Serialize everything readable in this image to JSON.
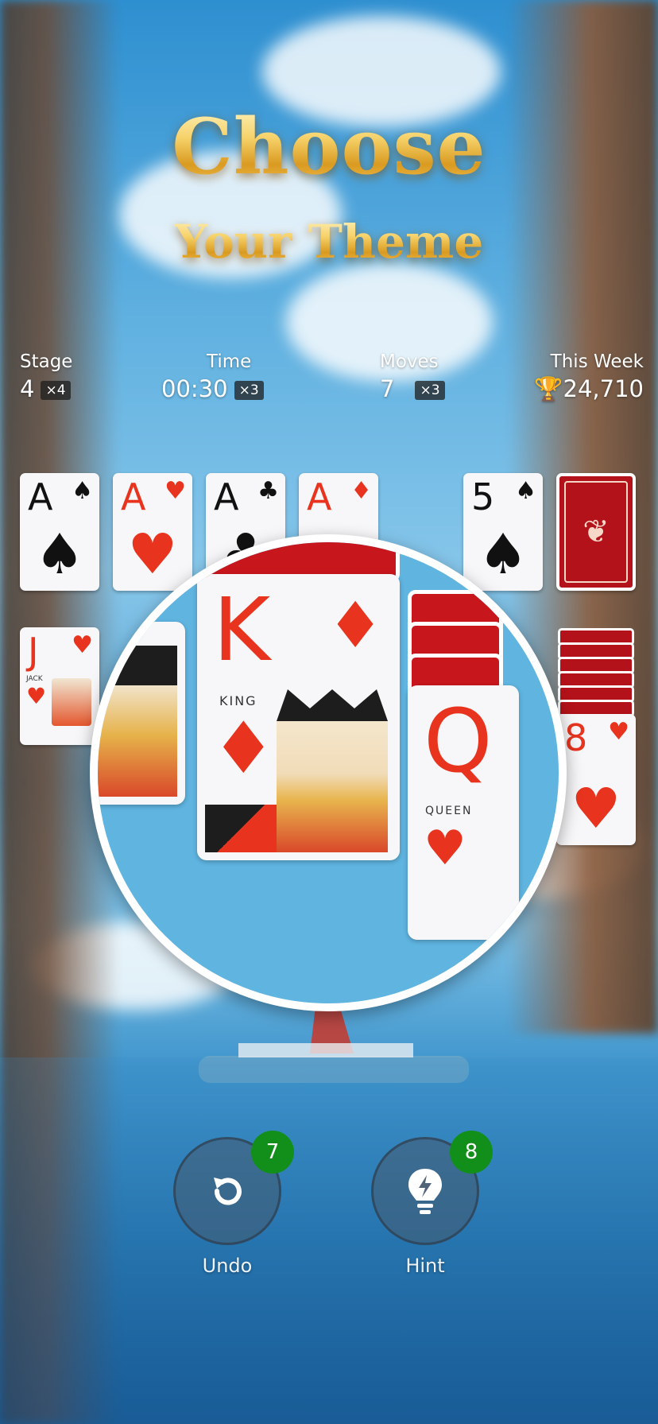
{
  "promo": {
    "title_line1": "Choose",
    "title_line2": "Your Theme"
  },
  "stats": {
    "stage": {
      "label": "Stage",
      "value": "4",
      "multiplier": "×4"
    },
    "time": {
      "label": "Time",
      "value": "00:30",
      "multiplier": "×3"
    },
    "moves": {
      "label": "Moves",
      "value": "7",
      "multiplier": "×3"
    },
    "week": {
      "label": "This Week",
      "value": "24,710",
      "icon": "trophy-icon"
    }
  },
  "foundations": [
    {
      "rank": "A",
      "suit": "♠",
      "color": "#111111"
    },
    {
      "rank": "A",
      "suit": "♥",
      "color": "#e8341e"
    },
    {
      "rank": "A",
      "suit": "♣",
      "color": "#111111"
    },
    {
      "rank": "A",
      "suit": "♦",
      "color": "#e8341e"
    }
  ],
  "waste_card": {
    "rank": "5",
    "suit": "♠"
  },
  "tableau_left": {
    "rank": "J",
    "suit": "♥",
    "face_label": "JACK"
  },
  "tableau_right": {
    "rank": "8",
    "suit": "♥"
  },
  "magnified": {
    "king": {
      "rank": "K",
      "suit": "♦",
      "label": "KING"
    },
    "queen": {
      "rank": "Q",
      "label": "QUEEN"
    }
  },
  "controls": {
    "undo": {
      "label": "Undo",
      "count": "7",
      "icon": "undo-icon"
    },
    "hint": {
      "label": "Hint",
      "count": "8",
      "icon": "lightbulb-icon"
    }
  }
}
